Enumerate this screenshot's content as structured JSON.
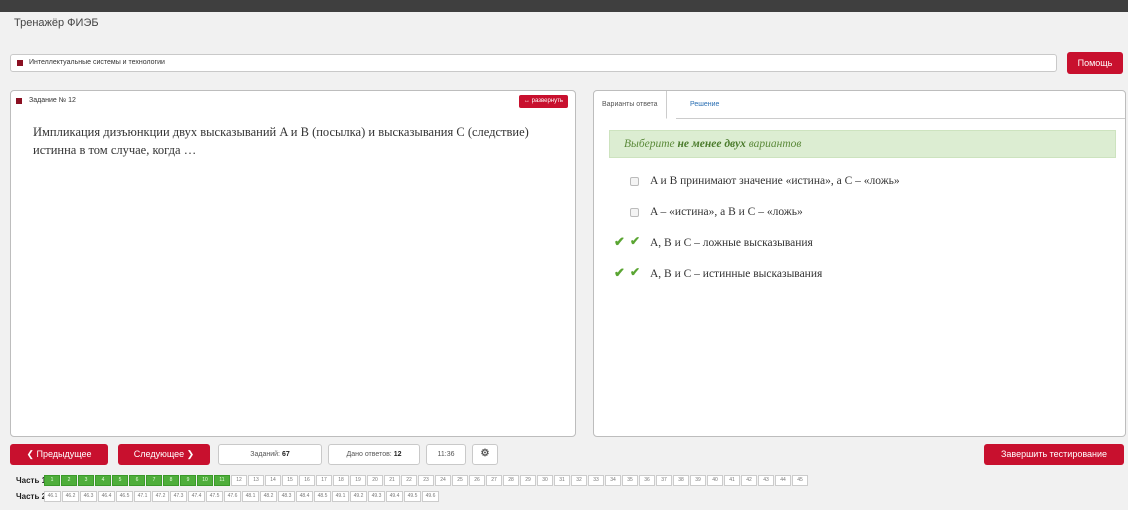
{
  "app": {
    "title": "Тренажёр ФИЭБ"
  },
  "subject": {
    "name": "Интеллектуальные системы и технологии",
    "help_label": "Помощь"
  },
  "task": {
    "heading": "Задание № 12",
    "expand_label": "↔ развернуть",
    "text": "Импликация дизъюнкции двух высказываний A и B (посылка) и высказывания C (следствие) истинна в том случае, когда …"
  },
  "answers": {
    "tabs": [
      "Варианты ответа",
      "Решение"
    ],
    "hint_pre": "Выберите ",
    "hint_bold": "не менее двух",
    "hint_post": " вариантов",
    "options": [
      {
        "text": "A и B принимают значение «истина», а C – «ложь»",
        "checked": false,
        "correct": false
      },
      {
        "text": "A – «истина», а B и C – «ложь»",
        "checked": false,
        "correct": false
      },
      {
        "text": "A, B и C – ложные высказывания",
        "checked": true,
        "correct": true
      },
      {
        "text": "A, B и C – истинные высказывания",
        "checked": true,
        "correct": true
      }
    ]
  },
  "nav": {
    "prev_label": "❮ Предыдущее",
    "next_label": "Следующее ❯",
    "tasks_label": "Заданий: ",
    "tasks_value": "67",
    "answers_label": "Дано ответов: ",
    "answers_value": "12",
    "time": "11:36",
    "finish_label": "Завершить тестирование",
    "settings_icon": "gear-icon"
  },
  "parts": [
    {
      "label": "Часть 1",
      "items": [
        "1",
        "2",
        "3",
        "4",
        "5",
        "6",
        "7",
        "8",
        "9",
        "10",
        "11",
        "12",
        "13",
        "14",
        "15",
        "16",
        "17",
        "18",
        "19",
        "20",
        "21",
        "22",
        "23",
        "24",
        "25",
        "26",
        "27",
        "28",
        "29",
        "30",
        "31",
        "32",
        "33",
        "34",
        "35",
        "36",
        "37",
        "38",
        "39",
        "40",
        "41",
        "42",
        "43",
        "44",
        "45"
      ],
      "done_count": 11
    },
    {
      "label": "Часть 2",
      "items": [
        "46.1",
        "46.2",
        "46.3",
        "46.4",
        "46.5",
        "47.1",
        "47.2",
        "47.3",
        "47.4",
        "47.5",
        "47.6",
        "48.1",
        "48.2",
        "48.3",
        "48.4",
        "48.5",
        "49.1",
        "49.2",
        "49.3",
        "49.4",
        "49.5",
        "49.6"
      ],
      "done_count": 0
    }
  ],
  "colors": {
    "accent": "#c8102e",
    "success": "#4fae3b",
    "hint_bg": "#dcedd2"
  }
}
